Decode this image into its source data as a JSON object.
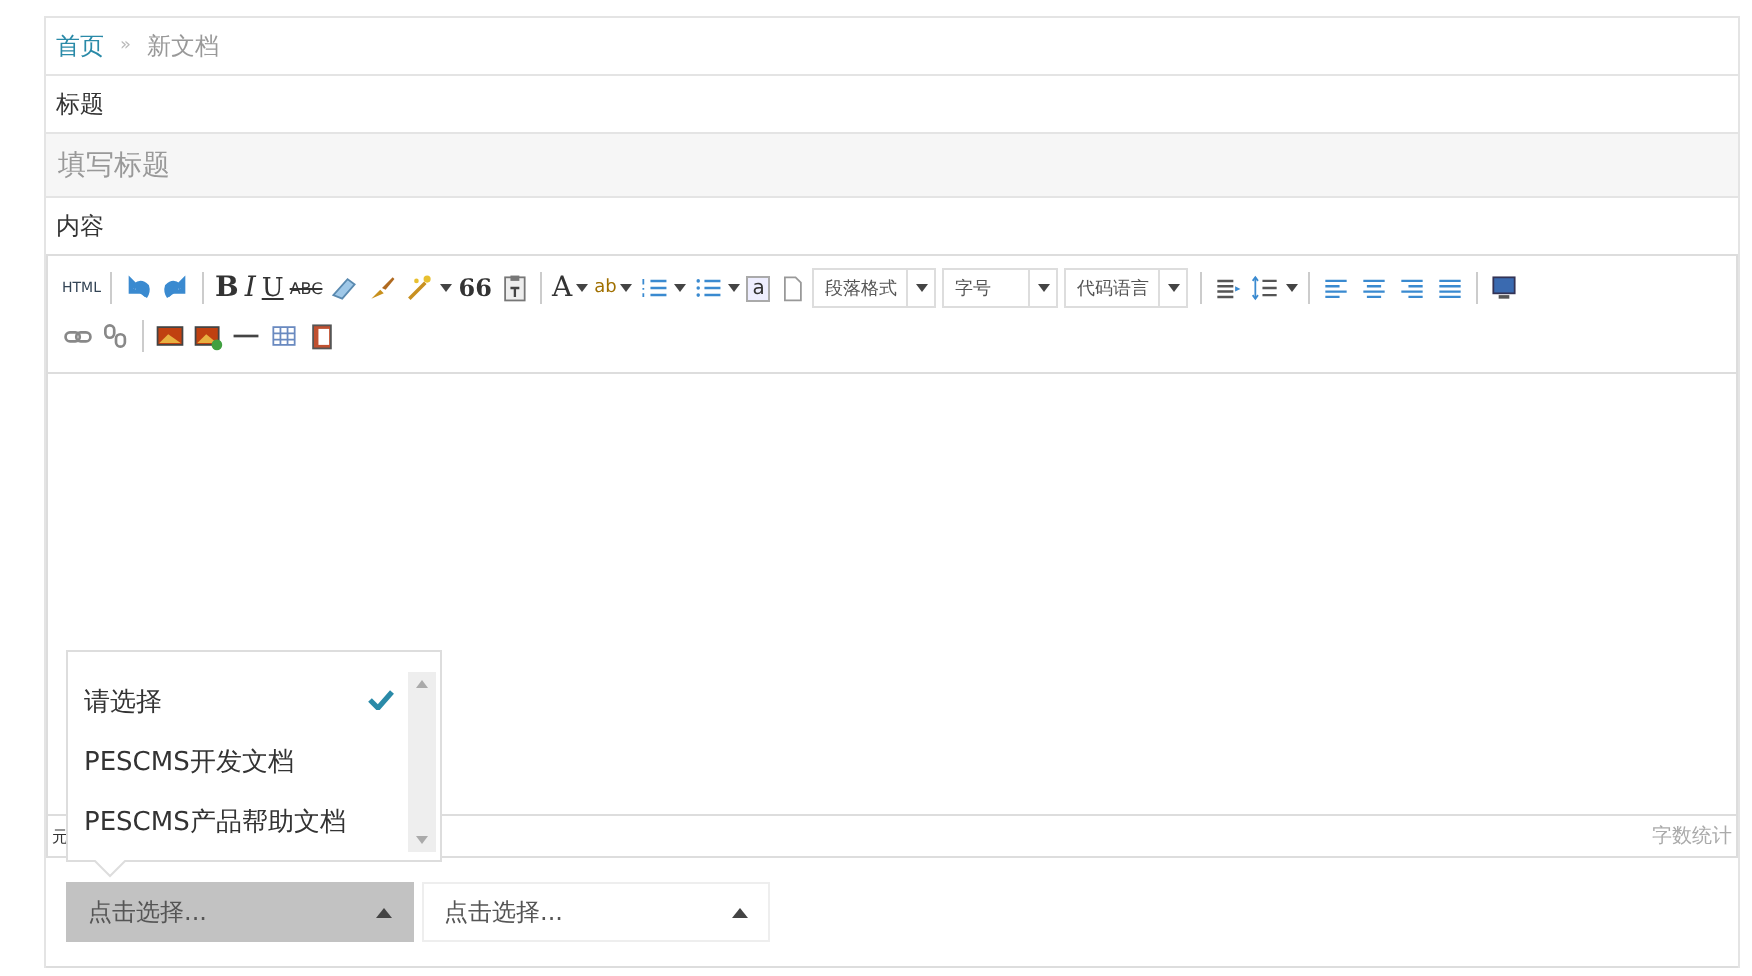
{
  "breadcrumb": {
    "home": "首页",
    "separator": "»",
    "current": "新文档"
  },
  "title_field": {
    "label": "标题",
    "placeholder": "填写标题"
  },
  "content_label": "内容",
  "toolbar": {
    "rows": [
      [
        {
          "kind": "html",
          "label": "HTML"
        },
        {
          "kind": "sep"
        },
        {
          "kind": "undo"
        },
        {
          "kind": "redo"
        },
        {
          "kind": "sep"
        },
        {
          "kind": "bold",
          "label": "B"
        },
        {
          "kind": "italic",
          "label": "I"
        },
        {
          "kind": "underline",
          "label": "U"
        },
        {
          "kind": "strike",
          "label": "ABC"
        },
        {
          "kind": "eraser"
        },
        {
          "kind": "brush"
        },
        {
          "kind": "wand",
          "caret": true
        },
        {
          "kind": "quote",
          "label": "66"
        },
        {
          "kind": "paste-text"
        },
        {
          "kind": "sep"
        },
        {
          "kind": "font-color",
          "label": "A",
          "caret": true
        },
        {
          "kind": "highlight",
          "label": "ab",
          "caret": true
        },
        {
          "kind": "list-numbered",
          "caret": true
        },
        {
          "kind": "list-bullet",
          "caret": true
        },
        {
          "kind": "letter",
          "label": "a"
        },
        {
          "kind": "page"
        },
        {
          "kind": "combo",
          "label": "段落格式"
        },
        {
          "kind": "combo",
          "label": "字号"
        },
        {
          "kind": "combo",
          "label": "代码语言"
        },
        {
          "kind": "sep"
        },
        {
          "kind": "indent"
        },
        {
          "kind": "line-height",
          "caret": true
        },
        {
          "kind": "sep"
        },
        {
          "kind": "align-left"
        },
        {
          "kind": "align-center"
        },
        {
          "kind": "align-right"
        },
        {
          "kind": "align-justify"
        },
        {
          "kind": "sep"
        },
        {
          "kind": "monitor"
        }
      ],
      [
        {
          "kind": "link"
        },
        {
          "kind": "unlink"
        },
        {
          "kind": "sep"
        },
        {
          "kind": "image"
        },
        {
          "kind": "image-add"
        },
        {
          "kind": "rule"
        },
        {
          "kind": "table"
        },
        {
          "kind": "clipboard"
        }
      ]
    ]
  },
  "status_bar": {
    "path": "元",
    "word_count": "字数统计"
  },
  "selects": [
    {
      "value": "点击选择...",
      "open": true
    },
    {
      "value": "点击选择...",
      "open": false
    }
  ],
  "dropdown": {
    "options": [
      {
        "label": "请选择",
        "selected": true
      },
      {
        "label": "PESCMS开发文档",
        "selected": false
      },
      {
        "label": "PESCMS产品帮助文档",
        "selected": false
      }
    ]
  }
}
